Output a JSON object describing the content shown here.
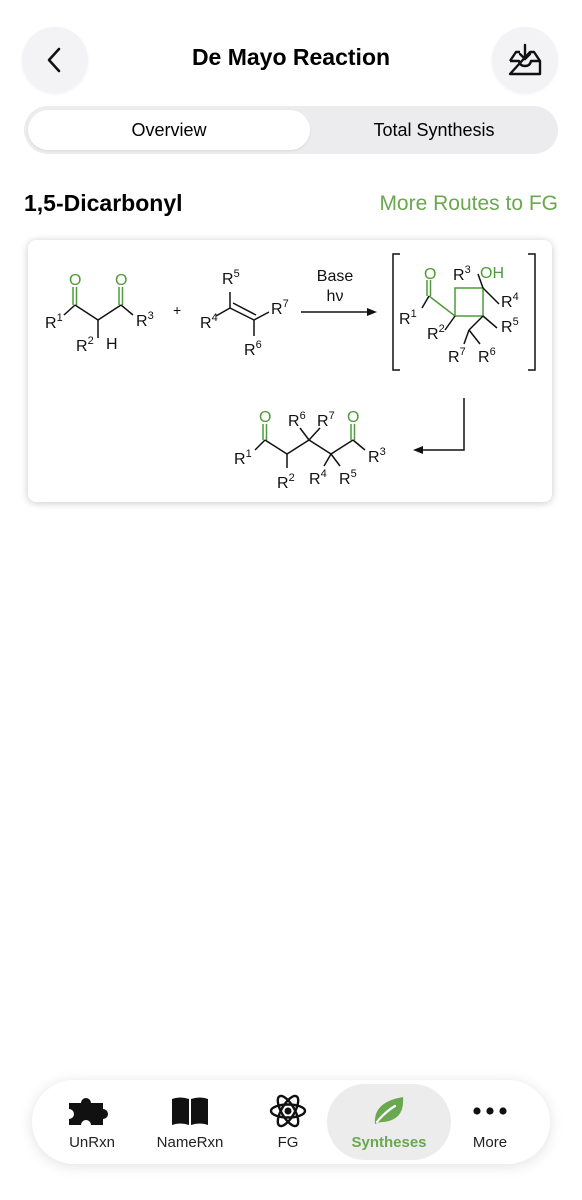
{
  "header": {
    "title": "De Mayo Reaction"
  },
  "tabs": {
    "overview": "Overview",
    "total_synthesis": "Total Synthesis"
  },
  "section": {
    "title": "1,5-Dicarbonyl",
    "link": "More Routes to FG"
  },
  "scheme": {
    "o": "O",
    "oh": "OH",
    "r": "R",
    "h": "H",
    "plus": "+",
    "conditions": [
      "Base",
      "hν"
    ],
    "superscripts": [
      "1",
      "2",
      "3",
      "4",
      "5",
      "6",
      "7"
    ]
  },
  "nav": [
    {
      "label": "UnRxn",
      "icon": "puzzle-icon"
    },
    {
      "label": "NameRxn",
      "icon": "book-icon"
    },
    {
      "label": "FG",
      "icon": "atom-icon"
    },
    {
      "label": "Syntheses",
      "icon": "leaf-icon"
    },
    {
      "label": "More",
      "icon": "more-dots-icon"
    }
  ],
  "colors": {
    "accent": "#6aa84f",
    "carbonyl": "#4f9a3a"
  }
}
